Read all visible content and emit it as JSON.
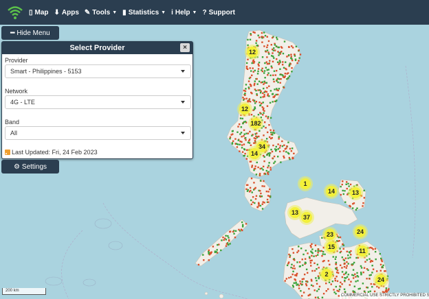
{
  "navbar": {
    "items": [
      {
        "label": "Map",
        "icon": "map-icon"
      },
      {
        "label": "Apps",
        "icon": "download-icon"
      },
      {
        "label": "Tools",
        "icon": "wrench-icon"
      },
      {
        "label": "Statistics",
        "icon": "bar-chart-icon"
      },
      {
        "label": "Help",
        "icon": "info-icon"
      },
      {
        "label": "Support",
        "icon": "question-icon"
      }
    ]
  },
  "hide_menu_label": "Hide Menu",
  "panel": {
    "title": "Select Provider",
    "close_label": "×",
    "provider_label": "Provider",
    "provider_value": "Smart - Philippines - 5153",
    "network_label": "Network",
    "network_value": "4G - LTE",
    "band_label": "Band",
    "band_value": "All",
    "last_updated": "Last Updated: Fri, 24 Feb 2023"
  },
  "settings_label": "Settings",
  "scale_label": "200 km",
  "attribution": "COMMERCIAL USE STRICTLY PROHIBITED Sign",
  "clusters": [
    "12",
    "12",
    "182",
    "34",
    "14",
    "1",
    "14",
    "13",
    "13",
    "37",
    "23",
    "24",
    "15",
    "11",
    "2",
    "24"
  ],
  "colors": {
    "navbar": "#2b3e50",
    "water": "#aad3df",
    "land": "#f2efe9",
    "cluster": "#f3f03a",
    "marker_red": "#d9502a",
    "marker_green": "#3aa23a"
  }
}
